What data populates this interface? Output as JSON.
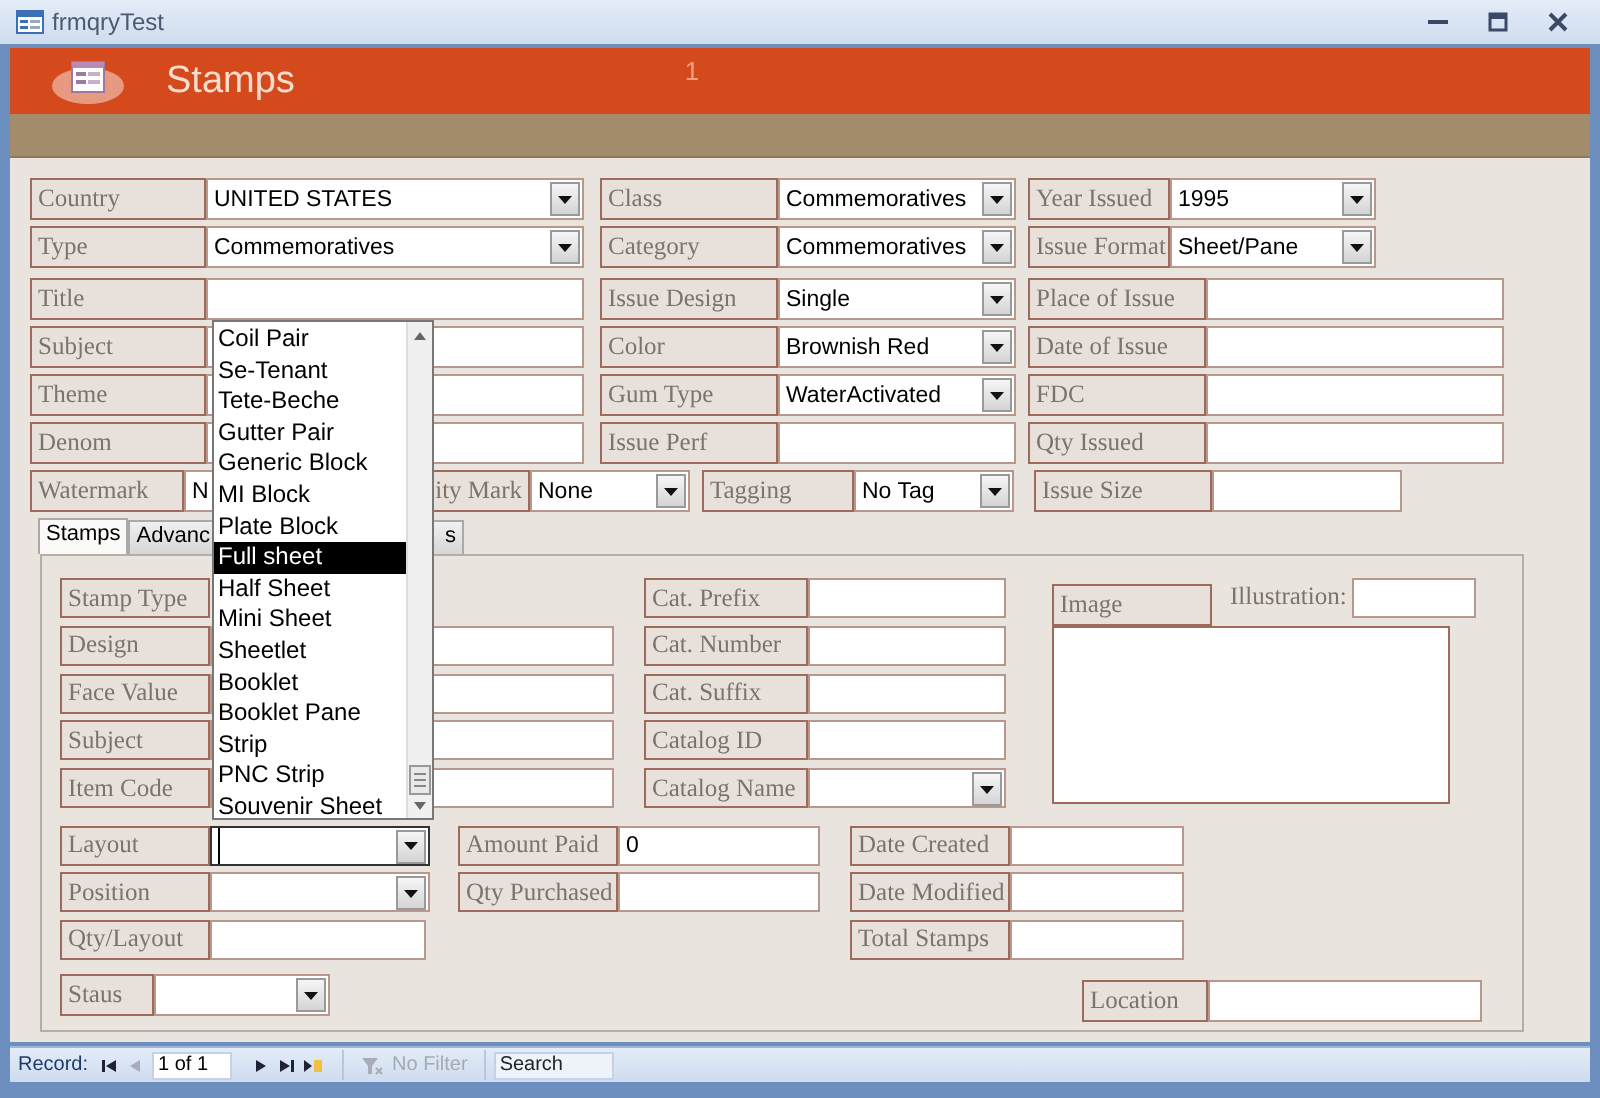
{
  "window": {
    "title": "frmqryTest"
  },
  "header": {
    "title": "Stamps",
    "record_number": "1"
  },
  "main_columns": [
    {
      "fields": [
        {
          "label": "Country",
          "kind": "combo",
          "value": "UNITED STATES"
        },
        {
          "label": "Type",
          "kind": "combo",
          "value": "Commemoratives"
        },
        {
          "label": "Title",
          "kind": "text"
        },
        {
          "label": "Subject",
          "kind": "text"
        },
        {
          "label": "Theme",
          "kind": "text"
        },
        {
          "label": "Denom",
          "kind": "text"
        }
      ]
    },
    {
      "fields": [
        {
          "label": "Class",
          "kind": "combo",
          "value": "Commemoratives"
        },
        {
          "label": "Category",
          "kind": "combo",
          "value": "Commemoratives"
        },
        {
          "label": "Issue Design",
          "kind": "combo",
          "value": "Single"
        },
        {
          "label": "Color",
          "kind": "combo",
          "value": "Brownish Red"
        },
        {
          "label": "Gum Type",
          "kind": "combo",
          "value": "WaterActivated"
        },
        {
          "label": "Issue Perf",
          "kind": "text"
        }
      ]
    },
    {
      "fields": [
        {
          "label": "Year Issued",
          "kind": "combo",
          "value": "1995"
        },
        {
          "label": "Issue Format",
          "kind": "combo",
          "value": "Sheet/Pane"
        },
        {
          "label": "Place of Issue",
          "kind": "text"
        },
        {
          "label": "Date of Issue",
          "kind": "text"
        },
        {
          "label": "FDC",
          "kind": "text"
        },
        {
          "label": "Qty Issued",
          "kind": "text"
        }
      ]
    }
  ],
  "main_row": [
    {
      "label": "Watermark",
      "kind": "text",
      "value": "N"
    },
    {
      "label": "ity Mark",
      "kind": "combo",
      "value": "None"
    },
    {
      "label": "Tagging",
      "kind": "combo",
      "value": "No Tag"
    },
    {
      "label": "Issue Size",
      "kind": "text"
    }
  ],
  "tabs": [
    {
      "label": "Stamps",
      "selected": true
    },
    {
      "label": "Advanc",
      "selected": false
    },
    {
      "label": "s",
      "selected": false
    }
  ],
  "panel_columns": [
    {
      "fields": [
        {
          "label": "Stamp Type",
          "kind": "label"
        },
        {
          "label": "Design",
          "kind": "text"
        },
        {
          "label": "Face Value",
          "kind": "text"
        },
        {
          "label": "Subject",
          "kind": "text"
        },
        {
          "label": "Item Code",
          "kind": "text"
        }
      ]
    },
    {
      "fields": [
        {
          "label": "Cat. Prefix",
          "kind": "text"
        },
        {
          "label": "Cat. Number",
          "kind": "text"
        },
        {
          "label": "Cat. Suffix",
          "kind": "text"
        },
        {
          "label": "Catalog ID",
          "kind": "text"
        },
        {
          "label": "Catalog Name",
          "kind": "combo"
        }
      ]
    }
  ],
  "image": {
    "label": "Image",
    "illustration_label": "Illustration:"
  },
  "lower_columns": [
    {
      "fields": [
        {
          "label": "Layout",
          "kind": "combo",
          "focused": true
        },
        {
          "label": "Position",
          "kind": "combo",
          "focused": false
        },
        {
          "label": "Qty/Layout",
          "kind": "text"
        }
      ]
    },
    {
      "fields": [
        {
          "label": "Amount Paid",
          "kind": "text",
          "value": "0"
        },
        {
          "label": "Qty Purchased",
          "kind": "text"
        }
      ]
    },
    {
      "fields": [
        {
          "label": "Date Created",
          "kind": "text"
        },
        {
          "label": "Date Modified",
          "kind": "text"
        },
        {
          "label": "Total Stamps",
          "kind": "text"
        }
      ]
    }
  ],
  "status_field": {
    "label": "Staus",
    "kind": "combo"
  },
  "location_field": {
    "label": "Location",
    "kind": "text"
  },
  "dropdown": {
    "items": [
      {
        "label": "Coil Pair",
        "selected": false
      },
      {
        "label": "Se-Tenant",
        "selected": false
      },
      {
        "label": "Tete-Beche",
        "selected": false
      },
      {
        "label": "Gutter Pair",
        "selected": false
      },
      {
        "label": "Generic Block",
        "selected": false
      },
      {
        "label": "MI Block",
        "selected": false
      },
      {
        "label": "Plate Block",
        "selected": false
      },
      {
        "label": "Full sheet",
        "selected": true
      },
      {
        "label": "Half Sheet",
        "selected": false
      },
      {
        "label": "Mini Sheet",
        "selected": false
      },
      {
        "label": "Sheetlet",
        "selected": false
      },
      {
        "label": "Booklet",
        "selected": false
      },
      {
        "label": "Booklet Pane",
        "selected": false
      },
      {
        "label": "Strip",
        "selected": false
      },
      {
        "label": "PNC Strip",
        "selected": false
      },
      {
        "label": "Souvenir Sheet",
        "selected": false
      }
    ]
  },
  "status_bar": {
    "label": "Record:",
    "position": "1 of 1",
    "filter": "No Filter",
    "search_placeholder": "Search"
  }
}
